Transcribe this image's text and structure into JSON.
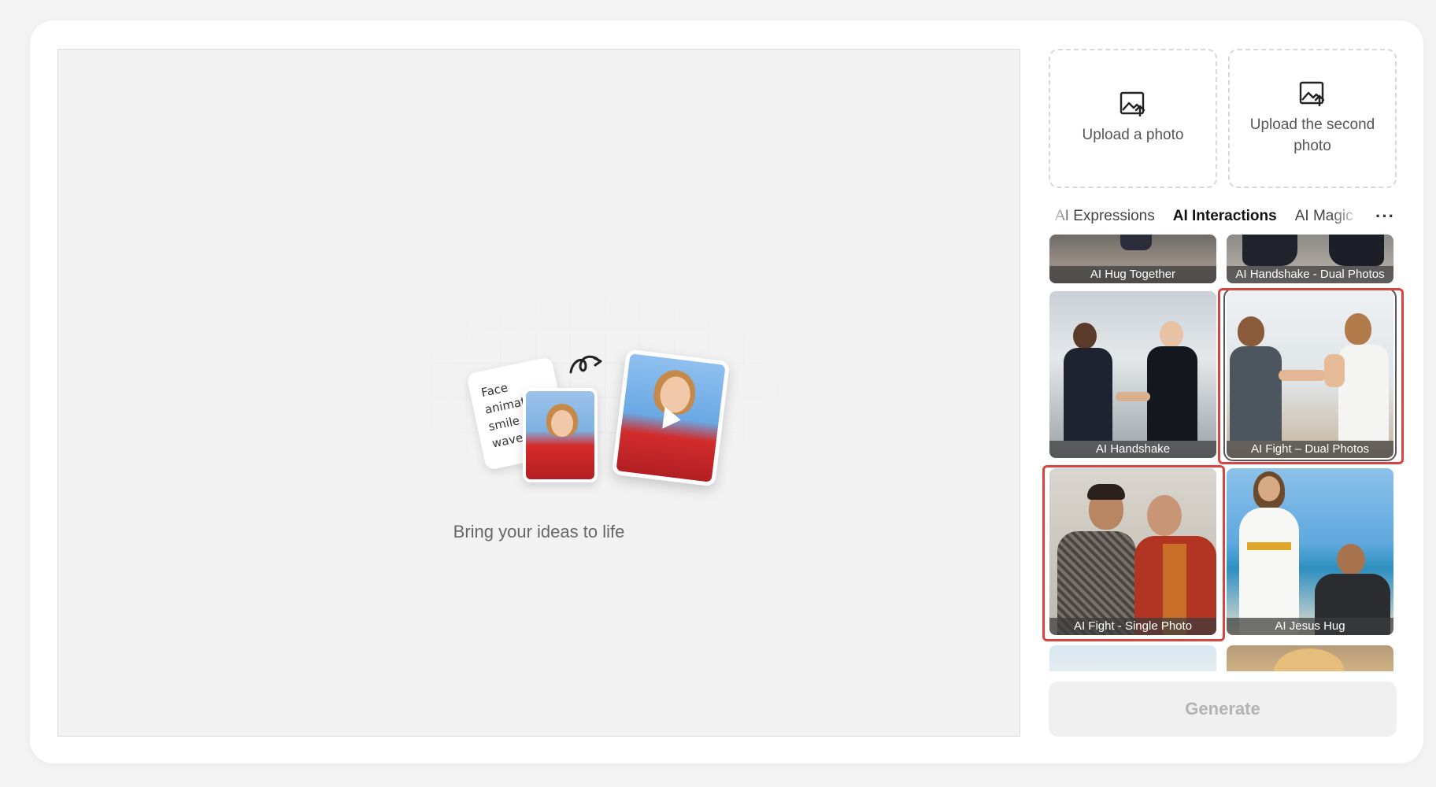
{
  "preview": {
    "note_text": "Face\nanimat\nsmile\nwave",
    "caption": "Bring your ideas to life"
  },
  "uploads": [
    {
      "label": "Upload a photo",
      "icon": "image-upload-icon"
    },
    {
      "label": "Upload the second photo",
      "icon": "image-upload-icon"
    }
  ],
  "tabs": [
    {
      "label": "AI Expressions",
      "active": false
    },
    {
      "label": "AI Interactions",
      "active": true
    },
    {
      "label": "AI Magic",
      "active": false
    }
  ],
  "more_label": "···",
  "gallery": [
    {
      "label": "AI Hug Together"
    },
    {
      "label": "AI Handshake - Dual Photos"
    },
    {
      "label": "AI Handshake"
    },
    {
      "label": "AI Fight – Dual Photos",
      "selected": true
    },
    {
      "label": "AI Fight - Single Photo",
      "highlighted": true
    },
    {
      "label": "AI Jesus Hug"
    },
    {
      "label": ""
    },
    {
      "label": ""
    }
  ],
  "generate_label": "Generate",
  "colors": {
    "highlight": "#d9443e",
    "generate_disabled_text": "#b3b3b3",
    "page_bg": "#f3f3f4"
  }
}
